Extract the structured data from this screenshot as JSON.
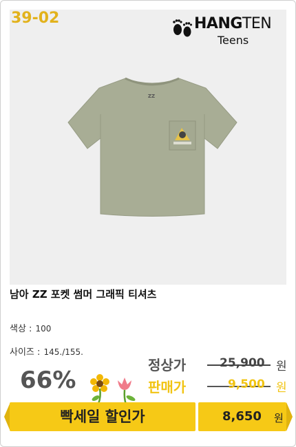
{
  "product": {
    "code": "39-02",
    "brand_main_a": "HANG",
    "brand_main_b": "TEN",
    "brand_sub": "Teens",
    "title": "남아 ZZ 포켓 썸머 그래픽 티셔츠",
    "color_label": "색상 :",
    "color_value": "100",
    "size_label": "사이즈 :",
    "size_value": "145./155."
  },
  "pricing": {
    "discount": "66%",
    "regular_label": "정상가",
    "regular_price": "25,900",
    "sale_label": "판매가",
    "sale_price": "9,500",
    "won": "원",
    "flash_label": "빡세일 할인가",
    "final_price": "8,650",
    "final_won": "원"
  },
  "colors": {
    "code_yellow": "#e2b21c",
    "label_gray": "#555555",
    "sale_yellow": "#f1c413",
    "bar_yellow": "#f6c916",
    "shirt_sage": "#a8ad95",
    "photo_bg": "#efefef"
  }
}
